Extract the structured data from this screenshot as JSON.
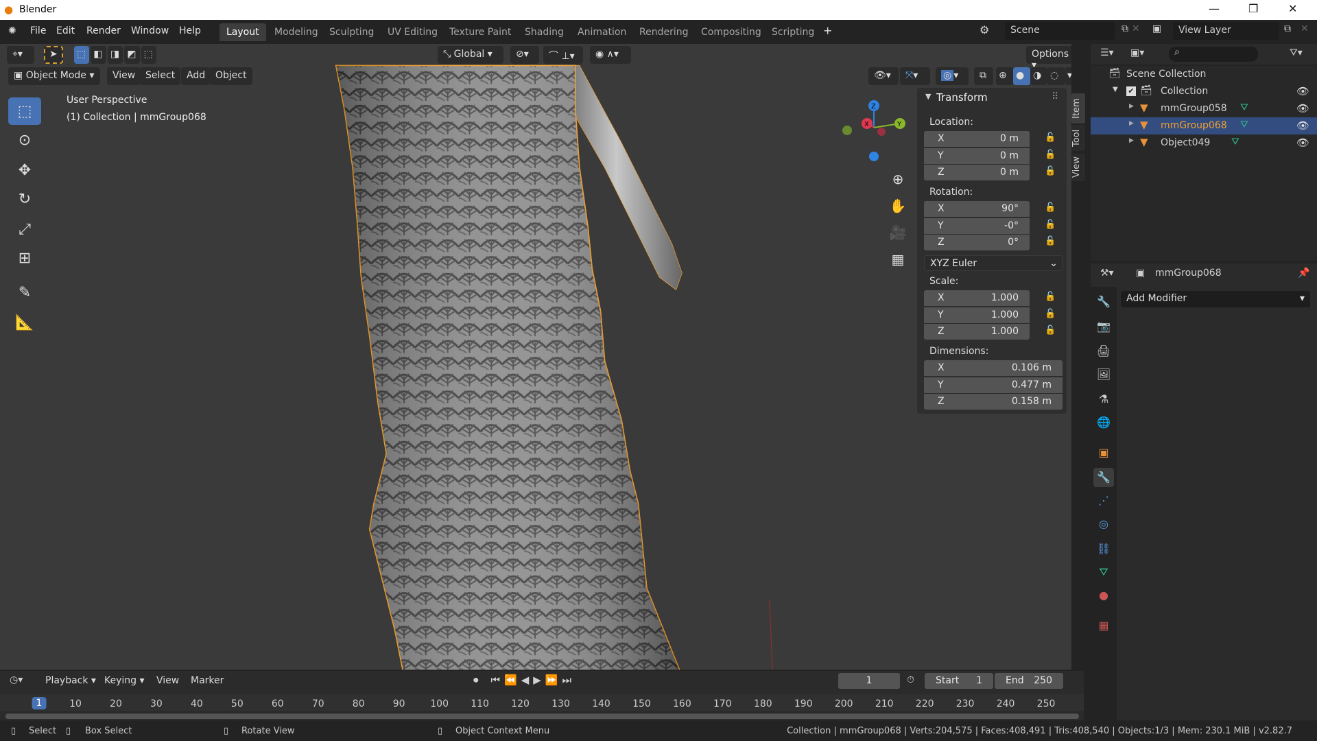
{
  "app": {
    "title": "Blender",
    "icon": "blender-logo-icon"
  },
  "window_controls": [
    "minimize",
    "maximize",
    "close"
  ],
  "menu": [
    "File",
    "Edit",
    "Render",
    "Window",
    "Help"
  ],
  "workspaces": [
    {
      "label": "Layout",
      "active": true
    },
    {
      "label": "Modeling"
    },
    {
      "label": "Sculpting"
    },
    {
      "label": "UV Editing"
    },
    {
      "label": "Texture Paint"
    },
    {
      "label": "Shading"
    },
    {
      "label": "Animation"
    },
    {
      "label": "Rendering"
    },
    {
      "label": "Compositing"
    },
    {
      "label": "Scripting"
    }
  ],
  "add_workspace": "+",
  "scene": {
    "name": "Scene",
    "view_layer": "View Layer"
  },
  "viewport_header": {
    "transform_orientation": "Global",
    "options": "Options",
    "mode": "Object Mode",
    "menus": [
      "View",
      "Select",
      "Add",
      "Object"
    ]
  },
  "viewport": {
    "perspective": "User Perspective",
    "collection_info": "(1) Collection | mmGroup068",
    "gizmo_axes": [
      "X",
      "Y",
      "Z"
    ]
  },
  "colors": {
    "accent": "#4772b3",
    "selection": "#f0a030",
    "bg": "#3a3a3a",
    "axis_x": "#e0394f",
    "axis_y": "#8ab82b",
    "axis_z": "#2f83e3"
  },
  "tools": [
    "select-box-icon",
    "cursor-icon",
    "move-icon",
    "rotate-icon",
    "scale-icon",
    "transform-icon",
    "annotate-icon",
    "measure-icon"
  ],
  "npanel": {
    "tabs": [
      "Item",
      "Tool",
      "View"
    ],
    "title": "Transform",
    "location": {
      "label": "Location:",
      "x": "0 m",
      "y": "0 m",
      "z": "0 m"
    },
    "rotation": {
      "label": "Rotation:",
      "x": "90°",
      "y": "-0°",
      "z": "0°",
      "mode": "XYZ Euler"
    },
    "scale": {
      "label": "Scale:",
      "x": "1.000",
      "y": "1.000",
      "z": "1.000"
    },
    "dimensions": {
      "label": "Dimensions:",
      "x": "0.106 m",
      "y": "0.477 m",
      "z": "0.158 m"
    },
    "axes": [
      "X",
      "Y",
      "Z"
    ]
  },
  "outliner": {
    "root": "Scene Collection",
    "collection": "Collection",
    "items": [
      {
        "name": "mmGroup058",
        "selected": false
      },
      {
        "name": "mmGroup068",
        "selected": true
      },
      {
        "name": "Object049",
        "selected": false
      }
    ]
  },
  "properties": {
    "object_name": "mmGroup068",
    "add_modifier": "Add Modifier",
    "tabs": [
      "tool-icon",
      "render-icon",
      "output-icon",
      "view-layer-icon",
      "scene-icon",
      "world-icon",
      "object-icon",
      "modifier-icon",
      "particles-icon",
      "physics-icon",
      "constraints-icon",
      "data-icon",
      "material-icon",
      "texture-icon"
    ],
    "active_tab": "modifier-icon"
  },
  "timeline": {
    "menus": [
      "Playback",
      "Keying",
      "View",
      "Marker"
    ],
    "current_frame": "1",
    "start_label": "Start",
    "start": "1",
    "end_label": "End",
    "end": "250",
    "ruler": [
      "1",
      "10",
      "20",
      "30",
      "40",
      "50",
      "60",
      "70",
      "80",
      "90",
      "100",
      "110",
      "120",
      "130",
      "140",
      "150",
      "160",
      "170",
      "180",
      "190",
      "200",
      "210",
      "220",
      "230",
      "240",
      "250"
    ]
  },
  "status": {
    "select": "Select",
    "box_select": "Box Select",
    "rotate_view": "Rotate View",
    "context_menu": "Object Context Menu",
    "stats": "Collection | mmGroup068 | Verts:204,575 | Faces:408,491 | Tris:408,540 | Objects:1/3 | Mem: 230.1 MiB | v2.82.7"
  }
}
